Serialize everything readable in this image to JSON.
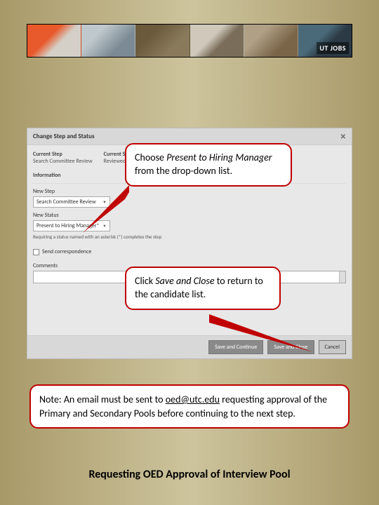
{
  "banner": {
    "logo_text": "UT JOBS"
  },
  "dialog": {
    "title": "Change Step and Status",
    "col1_label": "Current Step",
    "col1_value": "Search Committee Review",
    "col2_label": "Current Status",
    "col2_value": "Reviewed - Selected",
    "info_section": "Information",
    "newstep_label": "New Step",
    "newstep_value": "Search Committee Review",
    "newstatus_label": "New Status",
    "newstatus_value": "Present to Hiring Manager*",
    "asterisk_note": "Requiring a status named with an asterisk (*) completes the step",
    "checkbox_label": "Send correspondence",
    "comments_label": "Comments",
    "btn_save_continue": "Save and Continue",
    "btn_save_close": "Save and Close",
    "btn_cancel": "Cancel"
  },
  "callout1_pre": "Choose ",
  "callout1_em": "Present to Hiring Manager",
  "callout1_post": " from the drop-down list.",
  "callout2_pre": "Click ",
  "callout2_em": "Save and Close",
  "callout2_post": " to return to the candidate list.",
  "note_pre": "Note: An email must be sent to ",
  "note_link": "oed@utc.edu",
  "note_post": " requesting approval of the Primary and Secondary Pools before continuing to the next step.",
  "page_title": "Requesting OED Approval of Interview Pool"
}
